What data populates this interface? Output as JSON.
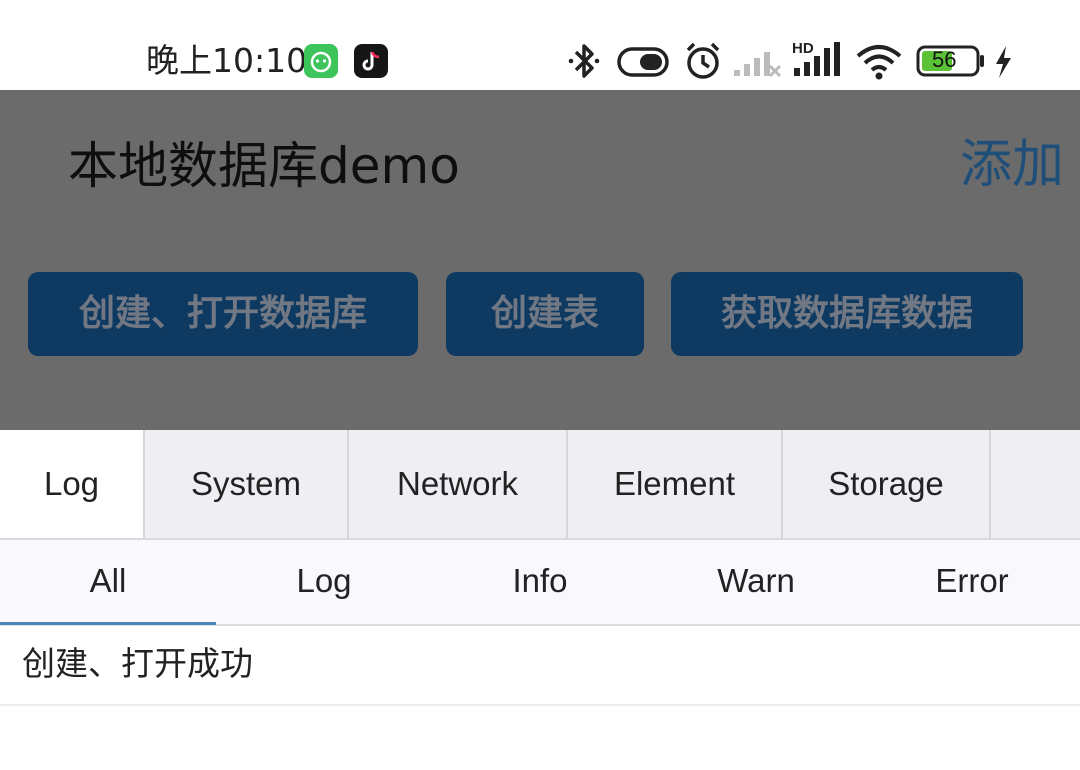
{
  "status_bar": {
    "time": "晚上10:10",
    "battery_level": "56",
    "icons": [
      "green-app-icon",
      "tiktok-icon",
      "bluetooth-icon",
      "toggle-icon",
      "alarm-icon",
      "signal-weak-icon",
      "hd-signal-icon",
      "wifi-icon",
      "battery-icon",
      "charging-icon"
    ]
  },
  "app_bar": {
    "title": "本地数据库demo",
    "add_label": "添加"
  },
  "actions": {
    "create_open_db": "创建、打开数据库",
    "create_table": "创建表",
    "fetch_db_data": "获取数据库数据"
  },
  "tool_tabs": [
    "Log",
    "System",
    "Network",
    "Element",
    "Storage"
  ],
  "filter_tabs": [
    "All",
    "Log",
    "Info",
    "Warn",
    "Error"
  ],
  "logs": [
    {
      "text": "创建、打开成功"
    }
  ],
  "colors": {
    "overlay": "#6b6b6b",
    "button": "#0e3a62",
    "accent": "#4a87b8"
  }
}
